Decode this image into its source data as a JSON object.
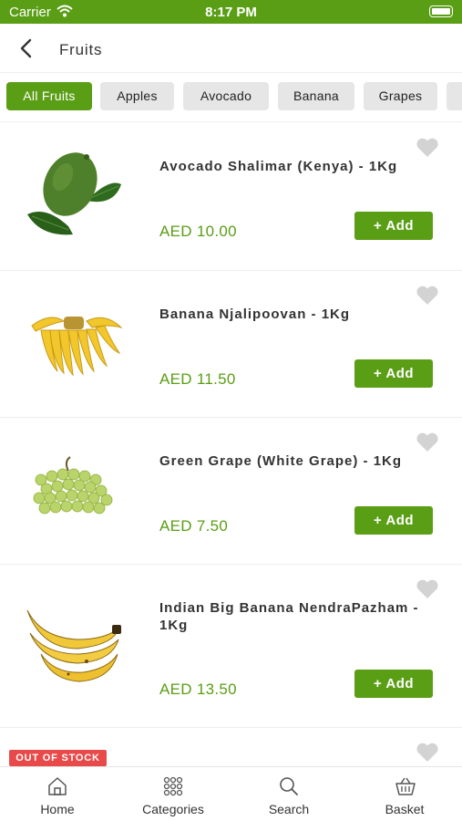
{
  "status_bar": {
    "carrier": "Carrier",
    "time": "8:17 PM"
  },
  "header": {
    "title": "Fruits",
    "back_icon": "chevron-left-icon"
  },
  "filters": [
    "All Fruits",
    "Apples",
    "Avocado",
    "Banana",
    "Grapes"
  ],
  "active_filter": "All Fruits",
  "products": [
    {
      "name": "Avocado Shalimar (Kenya) - 1Kg",
      "price": "AED 10.00",
      "button": "+ Add",
      "image": "avocado-image"
    },
    {
      "name": "Banana Njalipoovan - 1Kg",
      "price": "AED 11.50",
      "button": "+ Add",
      "image": "banana-bunch-image"
    },
    {
      "name": "Green Grape (White Grape) - 1Kg",
      "price": "AED 7.50",
      "button": "+ Add",
      "image": "green-grapes-image"
    },
    {
      "name": "Indian Big Banana NendraPazham - 1Kg",
      "price": "AED 13.50",
      "button": "+ Add",
      "image": "big-banana-image"
    },
    {
      "badge": "OUT OF STOCK"
    }
  ],
  "tabs": [
    {
      "label": "Home",
      "icon": "home-icon"
    },
    {
      "label": "Categories",
      "icon": "grid-icon"
    },
    {
      "label": "Search",
      "icon": "search-icon"
    },
    {
      "label": "Basket",
      "icon": "basket-icon"
    }
  ],
  "colors": {
    "brand": "#5a9e15",
    "out_of_stock": "#e84a4a",
    "heart": "#d3d3d3"
  }
}
